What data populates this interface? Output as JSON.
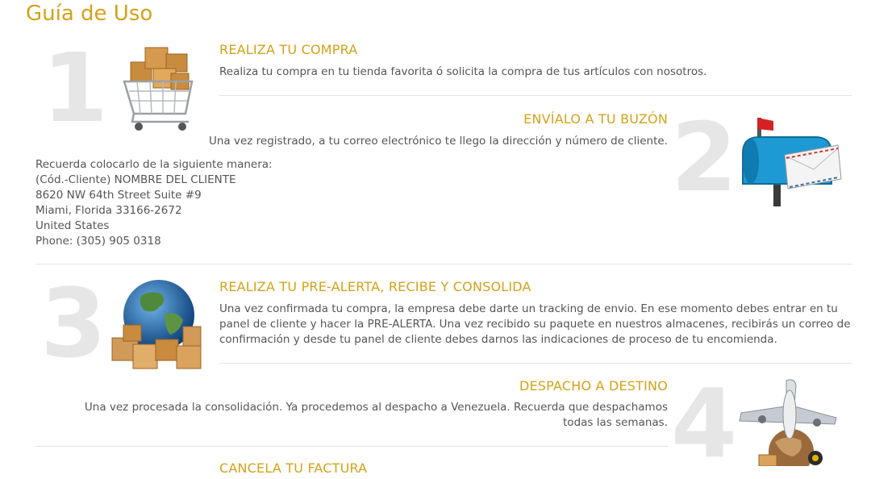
{
  "page": {
    "title": "Guía de Uso"
  },
  "steps": [
    {
      "number": "1",
      "heading": "REALIZA TU COMPRA",
      "text": "Realiza tu compra en tu tienda favorita ó solicita la compra de tus artículos con nosotros.",
      "icon": "shopping-cart-boxes-icon"
    },
    {
      "number": "2",
      "heading": "ENVÍALO A TU BUZÓN",
      "text": "Una vez registrado, a tu correo electrónico te llego la dirección y número de cliente.",
      "icon": "mailbox-icon",
      "address": {
        "intro": "Recuerda colocarlo de la siguiente manera:",
        "lines": [
          "(Cód.-Cliente) NOMBRE DEL CLIENTE",
          "8620 NW 64th Street Suite #9",
          "Miami, Florida 33166-2672",
          "United States",
          "Phone: (305) 905 0318"
        ]
      }
    },
    {
      "number": "3",
      "heading": "REALIZA TU PRE-ALERTA, RECIBE Y CONSOLIDA",
      "text": "Una vez confirmada tu compra, la empresa debe darte un tracking de envio. En ese momento debes entrar en tu panel de cliente y hacer la PRE-ALERTA. Una vez recibido su paquete en nuestros almacenes, recibirás un correo de confirmación y desde tu panel de cliente debes darnos las indicaciones de proceso de tu encomienda.",
      "icon": "globe-boxes-icon"
    },
    {
      "number": "4",
      "heading": "DESPACHO A DESTINO",
      "text": "Una vez procesada la consolidación. Ya procedemos al despacho a Venezuela. Recuerda que despachamos todas las semanas.",
      "icon": "airplane-globe-icon"
    },
    {
      "heading": "CANCELA TU FACTURA"
    }
  ]
}
